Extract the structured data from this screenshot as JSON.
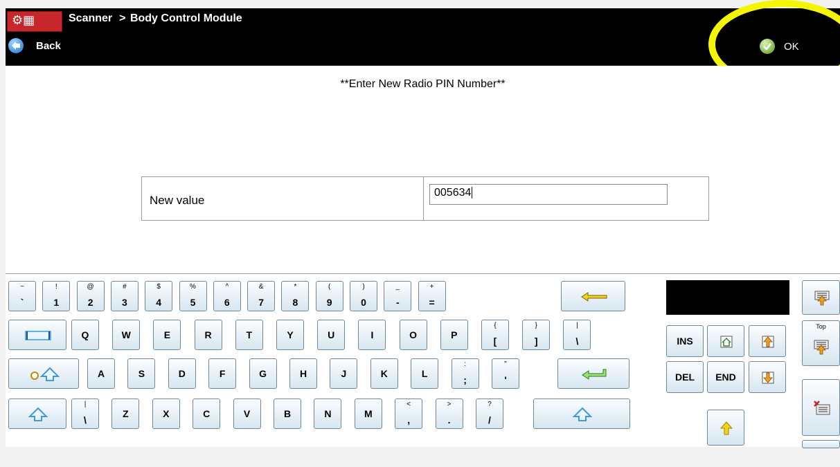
{
  "header": {
    "app": "Scanner",
    "breadcrumb_sep": ">",
    "module": "Body Control Module",
    "back_label": "Back",
    "ok_label": "OK"
  },
  "main": {
    "prompt": "**Enter New Radio PIN Number**",
    "field_label": "New value",
    "field_value": "005634"
  },
  "keyboard": {
    "row1": [
      {
        "s": "~",
        "b": "`"
      },
      {
        "s": "!",
        "b": "1"
      },
      {
        "s": "@",
        "b": "2"
      },
      {
        "s": "#",
        "b": "3"
      },
      {
        "s": "$",
        "b": "4"
      },
      {
        "s": "%",
        "b": "5"
      },
      {
        "s": "^",
        "b": "6"
      },
      {
        "s": "&",
        "b": "7"
      },
      {
        "s": "*",
        "b": "8"
      },
      {
        "s": "(",
        "b": "9"
      },
      {
        "s": ")",
        "b": "0"
      },
      {
        "s": "_",
        "b": "-"
      },
      {
        "s": "+",
        "b": "="
      }
    ],
    "row2": [
      {
        "s": "",
        "b": "Q"
      },
      {
        "s": "",
        "b": "W"
      },
      {
        "s": "",
        "b": "E"
      },
      {
        "s": "",
        "b": "R"
      },
      {
        "s": "",
        "b": "T"
      },
      {
        "s": "",
        "b": "Y"
      },
      {
        "s": "",
        "b": "U"
      },
      {
        "s": "",
        "b": "I"
      },
      {
        "s": "",
        "b": "O"
      },
      {
        "s": "",
        "b": "P"
      },
      {
        "s": "{",
        "b": "["
      },
      {
        "s": "}",
        "b": "]"
      },
      {
        "s": "|",
        "b": "\\"
      }
    ],
    "row3": [
      {
        "s": "",
        "b": "A"
      },
      {
        "s": "",
        "b": "S"
      },
      {
        "s": "",
        "b": "D"
      },
      {
        "s": "",
        "b": "F"
      },
      {
        "s": "",
        "b": "G"
      },
      {
        "s": "",
        "b": "H"
      },
      {
        "s": "",
        "b": "J"
      },
      {
        "s": "",
        "b": "K"
      },
      {
        "s": "",
        "b": "L"
      },
      {
        "s": ":",
        "b": ";"
      },
      {
        "s": "\"",
        "b": "'"
      }
    ],
    "row4": [
      {
        "s": "|",
        "b": "\\"
      },
      {
        "s": "",
        "b": "Z"
      },
      {
        "s": "",
        "b": "X"
      },
      {
        "s": "",
        "b": "C"
      },
      {
        "s": "",
        "b": "V"
      },
      {
        "s": "",
        "b": "B"
      },
      {
        "s": "",
        "b": "N"
      },
      {
        "s": "",
        "b": "M"
      },
      {
        "s": "<",
        "b": ","
      },
      {
        "s": ">",
        "b": "."
      },
      {
        "s": "?",
        "b": "/"
      }
    ],
    "nav": {
      "ins": "INS",
      "del": "DEL",
      "end": "END",
      "top": "Top"
    },
    "icons": {
      "backspace": "backspace-arrow-icon",
      "tab": "tab-icon",
      "capslock": "caps-lock-icon",
      "enter": "enter-icon",
      "shift": "shift-icon",
      "home": "home-icon",
      "page_up": "page-up-icon",
      "page_down": "page-down-icon",
      "up": "up-arrow-icon"
    },
    "colors": {
      "key_top": "#fbfdff",
      "key_bottom": "#d6e6f0",
      "arrow_yellow": "#f2d21b",
      "arrow_blue": "#3d97d8"
    }
  },
  "annotation": {
    "color": "#f5f500"
  }
}
